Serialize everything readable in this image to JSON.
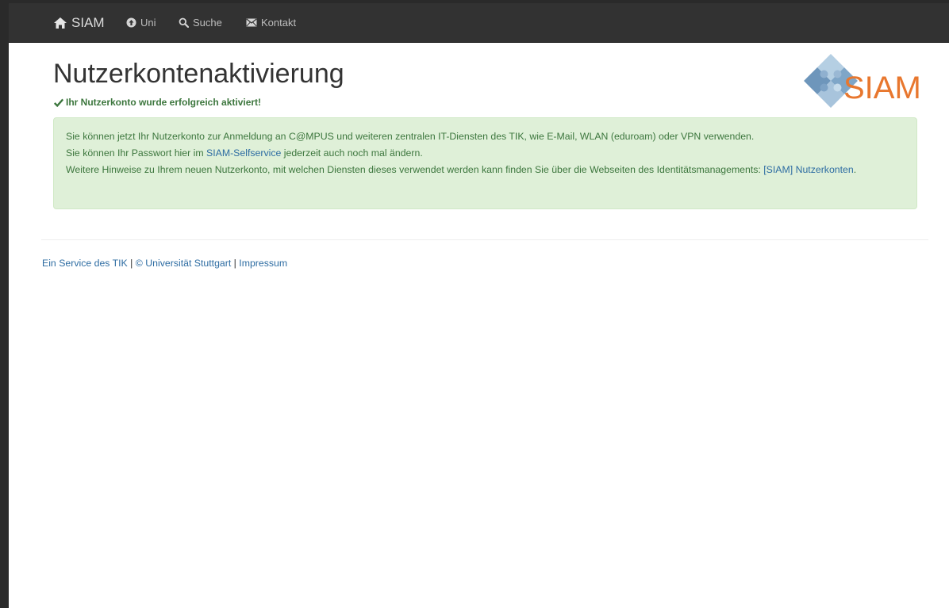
{
  "navbar": {
    "brand_label": "SIAM",
    "items": [
      {
        "label": "Uni",
        "icon": "circle-arrow-up-icon"
      },
      {
        "label": "Suche",
        "icon": "search-icon"
      },
      {
        "label": "Kontakt",
        "icon": "envelope-icon"
      }
    ]
  },
  "logo": {
    "text": "SIAM"
  },
  "main": {
    "title": "Nutzerkontenaktivierung",
    "success_message": "Ihr Nutzerkonto wurde erfolgreich aktiviert!",
    "alert": {
      "line1": "Sie können jetzt Ihr Nutzerkonto zur Anmeldung an C@MPUS und weiteren zentralen IT-Diensten des TIK, wie E-Mail, WLAN (eduroam) oder VPN verwenden.",
      "line2_before": "Sie können Ihr Passwort hier im ",
      "line2_link": "SIAM-Selfservice",
      "line2_after": " jederzeit auch noch mal ändern.",
      "line3_before": "Weitere Hinweise zu Ihrem neuen Nutzerkonto, mit welchen Diensten dieses verwendet werden kann finden Sie über die Webseiten des Identitätsmanagements: ",
      "line3_link": "[SIAM] Nutzerkonten",
      "line3_after": "."
    }
  },
  "footer": {
    "link1": "Ein Service des TIK",
    "sep1": " | ",
    "link2": "© Universität Stuttgart",
    "sep2": " | ",
    "link3": "Impressum"
  },
  "colors": {
    "navbar_bg": "#323232",
    "success_text": "#3c763d",
    "alert_bg": "#dff0d8",
    "link": "#2d6ca2",
    "logo_orange": "#e8772e"
  }
}
